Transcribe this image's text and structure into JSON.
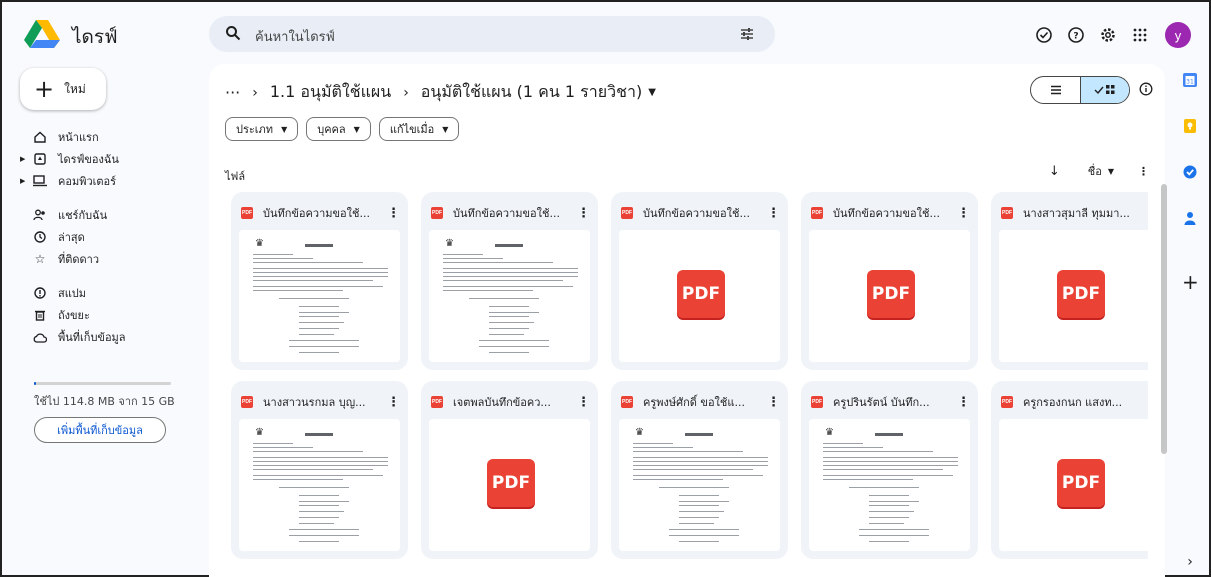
{
  "app": {
    "title": "ไดรฟ์"
  },
  "search": {
    "placeholder": "ค้นหาในไดรฟ์"
  },
  "top_icons": [
    "offline-ready-icon",
    "help-icon",
    "settings-icon",
    "apps-icon"
  ],
  "user": {
    "avatar_letter": "y",
    "avatar_color": "#9c27b0"
  },
  "new_button": {
    "label": "ใหม่"
  },
  "nav": {
    "home": "หน้าแรก",
    "my_drive": "ไดรฟ์ของฉัน",
    "computers": "คอมพิวเตอร์",
    "shared": "แชร์กับฉัน",
    "recent": "ล่าสุด",
    "starred": "ที่ติดดาว",
    "spam": "สแปม",
    "trash": "ถังขยะ",
    "storage": "พื้นที่เก็บข้อมูล"
  },
  "storage": {
    "used_text": "ใช้ไป 114.8 MB จาก 15 GB",
    "button": "เพิ่มพื้นที่เก็บข้อมูล",
    "used_fraction": 0.0075
  },
  "breadcrumb": {
    "ellipsis": "···",
    "sep": "›",
    "parent": "1.1 อนุมัติใช้แผน",
    "current": "อนุมัติใช้แผน (1 คน 1 รายวิชา)"
  },
  "filters": {
    "type": "ประเภท",
    "people": "บุคคล",
    "modified": "แก้ไขเมื่อ"
  },
  "files_label": "ไฟล์",
  "sort": {
    "label": "ชื่อ"
  },
  "files": [
    {
      "name": "บันทึกข้อความขอใช้...",
      "thumb": "doc"
    },
    {
      "name": "บันทึกข้อความขอใช้...",
      "thumb": "doc"
    },
    {
      "name": "บันทึกข้อความขอใช้...",
      "thumb": "pdf"
    },
    {
      "name": "บันทึกข้อความขอใช้...",
      "thumb": "pdf"
    },
    {
      "name": "นางสาวสุมาลี ทุมมา...",
      "thumb": "pdf"
    },
    {
      "name": "นางสาวนรกมล บุญ...",
      "thumb": "doc"
    },
    {
      "name": "เจตพลบันทึกข้อคว...",
      "thumb": "pdf"
    },
    {
      "name": "ครูพงษ์ศักดิ์ ขอใช้แ...",
      "thumb": "doc"
    },
    {
      "name": "ครูปรินรัตน์ บันทึก...",
      "thumb": "doc"
    },
    {
      "name": "ครูกรองกนก แสงท...",
      "thumb": "pdf"
    }
  ],
  "pdf_badge": "PDF",
  "pdf_mini": "PDF",
  "colors": {
    "pdf_red": "#ea4335",
    "accent_blue": "#0b57d0",
    "selected": "#c2e7ff"
  }
}
